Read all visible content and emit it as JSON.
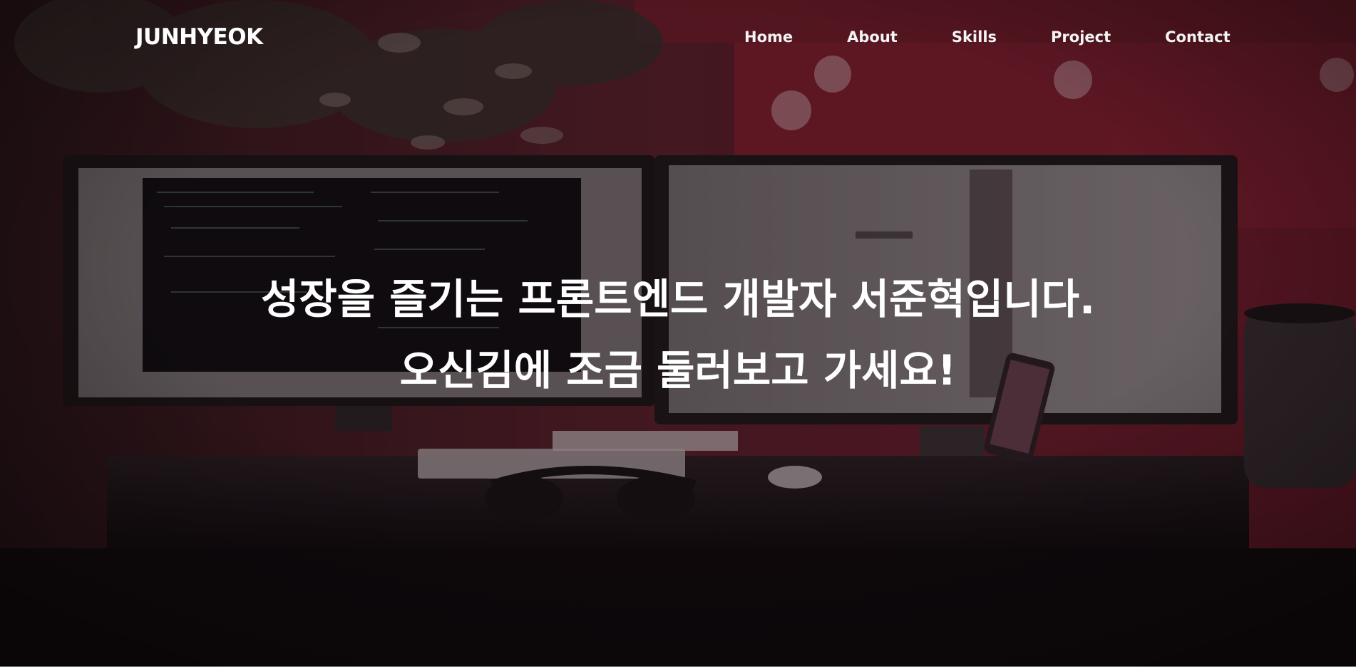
{
  "header": {
    "logo": "JUNHYEOK",
    "nav": [
      {
        "label": "Home"
      },
      {
        "label": "About"
      },
      {
        "label": "Skills"
      },
      {
        "label": "Project"
      },
      {
        "label": "Contact"
      }
    ]
  },
  "hero": {
    "line1": "성장을 즐기는 프론트엔드 개발자 서준혁입니다.",
    "line2": "오신김에 조금 둘러보고 가세요!"
  },
  "colors": {
    "overlay": "#140b0f",
    "accent_red": "#b81e38",
    "text": "#ffffff"
  }
}
